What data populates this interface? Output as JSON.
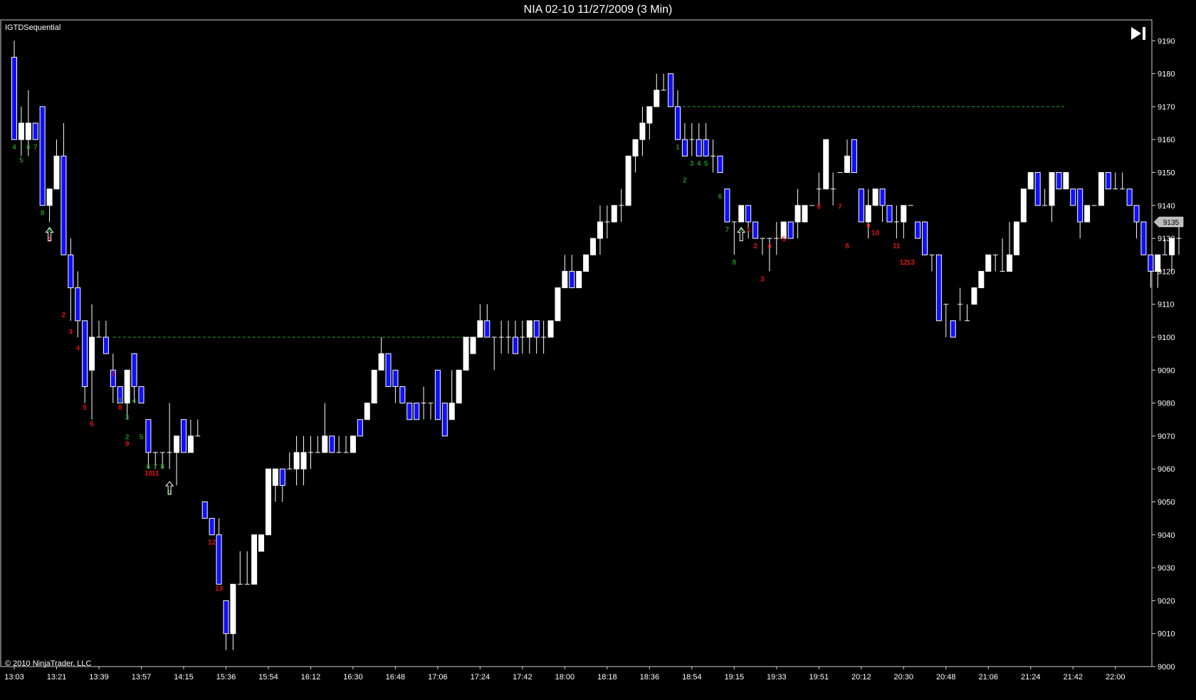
{
  "title": "NIA 02-10  11/27/2009 (3 Min)",
  "indicator_label": "IGTDSequential",
  "copyright": "© 2010 NinjaTrader, LLC",
  "last_price_label": "9135",
  "colors": {
    "background": "#000000",
    "up_candle": "#ffffff",
    "down_candle": "#1010ff",
    "setup_count": "#1e8c1e",
    "countdown_count": "#e01010",
    "support_resistance": "#1e8c1e"
  },
  "chart_data": {
    "type": "candlestick",
    "ylim": [
      9000,
      9195
    ],
    "yticks": [
      9000,
      9010,
      9020,
      9030,
      9040,
      9050,
      9060,
      9070,
      9080,
      9090,
      9100,
      9110,
      9120,
      9130,
      9140,
      9150,
      9160,
      9170,
      9180,
      9190
    ],
    "xticks": [
      "13:03",
      "13:21",
      "13:39",
      "13:57",
      "14:15",
      "15:36",
      "15:54",
      "16:12",
      "16:30",
      "16:48",
      "17:06",
      "17:24",
      "17:42",
      "18:00",
      "18:18",
      "18:36",
      "18:54",
      "19:15",
      "19:33",
      "19:51",
      "20:12",
      "20:30",
      "20:48",
      "21:06",
      "21:24",
      "21:42",
      "22:00"
    ],
    "last_price": 9135,
    "candles": [
      [
        9185,
        9190,
        9160,
        9160
      ],
      [
        9160,
        9170,
        9155,
        9165
      ],
      [
        9160,
        9175,
        9155,
        9165
      ],
      [
        9165,
        9165,
        9160,
        9160
      ],
      [
        9170,
        9170,
        9140,
        9140
      ],
      [
        9140,
        9145,
        9135,
        9145
      ],
      [
        9145,
        9160,
        9145,
        9155
      ],
      [
        9155,
        9165,
        9125,
        9125
      ],
      [
        9125,
        9130,
        9105,
        9115
      ],
      [
        9115,
        9120,
        9100,
        9105
      ],
      [
        9105,
        9105,
        9080,
        9085
      ],
      [
        9090,
        9110,
        9075,
        9100
      ],
      [
        9100,
        9105,
        9100,
        9100
      ],
      [
        9100,
        9105,
        9095,
        9095
      ],
      [
        9090,
        9095,
        9080,
        9085
      ],
      [
        9085,
        9085,
        9080,
        9080
      ],
      [
        9080,
        9090,
        9075,
        9090
      ],
      [
        9095,
        9095,
        9080,
        9085
      ],
      [
        9085,
        9085,
        9080,
        9080
      ],
      [
        9075,
        9075,
        9060,
        9065
      ],
      [
        9065,
        9065,
        9060,
        9065
      ],
      [
        9065,
        9065,
        9060,
        9065
      ],
      [
        9065,
        9080,
        9060,
        9065
      ],
      [
        9065,
        9070,
        9055,
        9070
      ],
      [
        9075,
        9075,
        9065,
        9065
      ],
      [
        9065,
        9075,
        9065,
        9070
      ],
      [
        9070,
        9075,
        9070,
        9070
      ],
      [
        9050,
        9050,
        9045,
        9045
      ],
      [
        9045,
        9045,
        9040,
        9040
      ],
      [
        9040,
        9045,
        9025,
        9025
      ],
      [
        9020,
        9020,
        9005,
        9010
      ],
      [
        9010,
        9025,
        9005,
        9025
      ],
      [
        9025,
        9035,
        9025,
        9025
      ],
      [
        9025,
        9035,
        9025,
        9025
      ],
      [
        9025,
        9040,
        9025,
        9040
      ],
      [
        9035,
        9040,
        9035,
        9040
      ],
      [
        9040,
        9060,
        9040,
        9060
      ],
      [
        9055,
        9060,
        9050,
        9060
      ],
      [
        9060,
        9060,
        9050,
        9055
      ],
      [
        9060,
        9065,
        9060,
        9060
      ],
      [
        9060,
        9070,
        9055,
        9065
      ],
      [
        9060,
        9070,
        9055,
        9065
      ],
      [
        9065,
        9070,
        9060,
        9065
      ],
      [
        9065,
        9070,
        9065,
        9065
      ],
      [
        9065,
        9080,
        9065,
        9070
      ],
      [
        9070,
        9070,
        9065,
        9065
      ],
      [
        9065,
        9070,
        9065,
        9065
      ],
      [
        9065,
        9070,
        9065,
        9065
      ],
      [
        9065,
        9070,
        9065,
        9070
      ],
      [
        9075,
        9075,
        9070,
        9070
      ],
      [
        9075,
        9080,
        9075,
        9080
      ],
      [
        9080,
        9090,
        9080,
        9090
      ],
      [
        9090,
        9100,
        9090,
        9095
      ],
      [
        9095,
        9095,
        9085,
        9085
      ],
      [
        9090,
        9090,
        9080,
        9085
      ],
      [
        9085,
        9085,
        9080,
        9080
      ],
      [
        9080,
        9080,
        9075,
        9075
      ],
      [
        9080,
        9080,
        9075,
        9075
      ],
      [
        9080,
        9085,
        9075,
        9080
      ],
      [
        9080,
        9080,
        9075,
        9080
      ],
      [
        9090,
        9090,
        9075,
        9075
      ],
      [
        9080,
        9080,
        9070,
        9070
      ],
      [
        9075,
        9090,
        9075,
        9080
      ],
      [
        9080,
        9090,
        9080,
        9090
      ],
      [
        9090,
        9100,
        9090,
        9100
      ],
      [
        9095,
        9100,
        9095,
        9100
      ],
      [
        9100,
        9110,
        9100,
        9105
      ],
      [
        9105,
        9110,
        9100,
        9100
      ],
      [
        9100,
        9100,
        9090,
        9100
      ],
      [
        9100,
        9105,
        9095,
        9100
      ],
      [
        9100,
        9105,
        9095,
        9100
      ],
      [
        9100,
        9105,
        9095,
        9095
      ],
      [
        9100,
        9105,
        9095,
        9100
      ],
      [
        9100,
        9105,
        9095,
        9105
      ],
      [
        9105,
        9105,
        9095,
        9100
      ],
      [
        9100,
        9105,
        9095,
        9100
      ],
      [
        9100,
        9105,
        9100,
        9105
      ],
      [
        9105,
        9115,
        9105,
        9115
      ],
      [
        9115,
        9125,
        9115,
        9120
      ],
      [
        9120,
        9125,
        9115,
        9115
      ],
      [
        9115,
        9120,
        9115,
        9120
      ],
      [
        9120,
        9125,
        9120,
        9125
      ],
      [
        9125,
        9130,
        9125,
        9130
      ],
      [
        9130,
        9140,
        9125,
        9135
      ],
      [
        9135,
        9140,
        9130,
        9135
      ],
      [
        9135,
        9140,
        9135,
        9140
      ],
      [
        9140,
        9145,
        9135,
        9140
      ],
      [
        9140,
        9155,
        9140,
        9155
      ],
      [
        9155,
        9160,
        9150,
        9160
      ],
      [
        9160,
        9170,
        9155,
        9165
      ],
      [
        9165,
        9170,
        9160,
        9170
      ],
      [
        9170,
        9180,
        9170,
        9175
      ],
      [
        9175,
        9180,
        9175,
        9175
      ],
      [
        9180,
        9180,
        9170,
        9170
      ],
      [
        9170,
        9175,
        9160,
        9160
      ],
      [
        9160,
        9165,
        9155,
        9155
      ],
      [
        9160,
        9165,
        9155,
        9160
      ],
      [
        9160,
        9165,
        9155,
        9155
      ],
      [
        9160,
        9165,
        9155,
        9155
      ],
      [
        9155,
        9160,
        9150,
        9155
      ],
      [
        9155,
        9155,
        9150,
        9150
      ],
      [
        9145,
        9145,
        9135,
        9135
      ],
      [
        9135,
        9135,
        9125,
        9135
      ],
      [
        9135,
        9140,
        9135,
        9140
      ],
      [
        9140,
        9140,
        9130,
        9135
      ],
      [
        9135,
        9135,
        9130,
        9130
      ],
      [
        9130,
        9130,
        9125,
        9130
      ],
      [
        9130,
        9130,
        9120,
        9130
      ],
      [
        9130,
        9135,
        9125,
        9130
      ],
      [
        9130,
        9135,
        9130,
        9135
      ],
      [
        9135,
        9135,
        9130,
        9130
      ],
      [
        9135,
        9145,
        9130,
        9140
      ],
      [
        9135,
        9140,
        9135,
        9140
      ],
      [
        9140,
        9140,
        9140,
        9140
      ],
      [
        9145,
        9150,
        9140,
        9145
      ],
      [
        9145,
        9160,
        9145,
        9160
      ],
      [
        9145,
        9150,
        9140,
        9145
      ],
      [
        9150,
        9150,
        9150,
        9150
      ],
      [
        9150,
        9160,
        9150,
        9155
      ],
      [
        9160,
        9160,
        9150,
        9150
      ],
      [
        9145,
        9145,
        9135,
        9135
      ],
      [
        9135,
        9145,
        9130,
        9140
      ],
      [
        9140,
        9145,
        9140,
        9145
      ],
      [
        9145,
        9145,
        9135,
        9140
      ],
      [
        9140,
        9140,
        9135,
        9135
      ],
      [
        9135,
        9140,
        9130,
        9135
      ],
      [
        9135,
        9140,
        9130,
        9140
      ],
      [
        9140,
        9140,
        9140,
        9140
      ],
      [
        9135,
        9135,
        9130,
        9130
      ],
      [
        9135,
        9135,
        9125,
        9125
      ],
      [
        9125,
        9125,
        9120,
        9125
      ],
      [
        9125,
        9125,
        9105,
        9105
      ],
      [
        9110,
        9110,
        9100,
        9110
      ],
      [
        9105,
        9105,
        9100,
        9100
      ],
      [
        9110,
        9115,
        9105,
        9110
      ],
      [
        9105,
        9110,
        9105,
        9105
      ],
      [
        9110,
        9115,
        9110,
        9115
      ],
      [
        9115,
        9120,
        9115,
        9120
      ],
      [
        9120,
        9125,
        9120,
        9125
      ],
      [
        9125,
        9125,
        9120,
        9125
      ],
      [
        9120,
        9130,
        9120,
        9120
      ],
      [
        9120,
        9135,
        9120,
        9125
      ],
      [
        9125,
        9135,
        9125,
        9135
      ],
      [
        9135,
        9145,
        9135,
        9145
      ],
      [
        9145,
        9150,
        9145,
        9150
      ],
      [
        9150,
        9150,
        9145,
        9140
      ],
      [
        9140,
        9145,
        9140,
        9140
      ],
      [
        9140,
        9150,
        9135,
        9150
      ],
      [
        9150,
        9150,
        9145,
        9145
      ],
      [
        9145,
        9150,
        9145,
        9150
      ],
      [
        9145,
        9145,
        9140,
        9140
      ],
      [
        9145,
        9145,
        9130,
        9135
      ],
      [
        9135,
        9140,
        9135,
        9140
      ],
      [
        9140,
        9140,
        9140,
        9140
      ],
      [
        9140,
        9150,
        9140,
        9150
      ],
      [
        9150,
        9150,
        9145,
        9145
      ],
      [
        9145,
        9150,
        9145,
        9145
      ],
      [
        9145,
        9150,
        9145,
        9145
      ],
      [
        9145,
        9145,
        9140,
        9140
      ],
      [
        9140,
        9140,
        9130,
        9135
      ],
      [
        9135,
        9135,
        9125,
        9125
      ],
      [
        9125,
        9125,
        9115,
        9120
      ],
      [
        9120,
        9125,
        9115,
        9125
      ],
      [
        9125,
        9130,
        9125,
        9125
      ],
      [
        9125,
        9130,
        9120,
        9130
      ],
      [
        9130,
        9135,
        9125,
        9130
      ]
    ],
    "counts": [
      {
        "bar": 0,
        "text": "4",
        "kind": "setup",
        "price": 9157
      },
      {
        "bar": 1,
        "text": "5",
        "kind": "setup",
        "price": 9153
      },
      {
        "bar": 2,
        "text": "6",
        "kind": "setup",
        "price": 9157
      },
      {
        "bar": 3,
        "text": "7",
        "kind": "setup",
        "price": 9157
      },
      {
        "bar": 4,
        "text": "8",
        "kind": "setup",
        "price": 9137
      },
      {
        "bar": 5,
        "text": "9",
        "kind": "setup",
        "price": 9132
      },
      {
        "bar": 5,
        "text": "1",
        "kind": "countdown",
        "price": 9129
      },
      {
        "bar": 7,
        "text": "2",
        "kind": "countdown",
        "price": 9106
      },
      {
        "bar": 8,
        "text": "3",
        "kind": "countdown",
        "price": 9101
      },
      {
        "bar": 9,
        "text": "4",
        "kind": "countdown",
        "price": 9096
      },
      {
        "bar": 10,
        "text": "5",
        "kind": "countdown",
        "price": 9078
      },
      {
        "bar": 11,
        "text": "6",
        "kind": "countdown",
        "price": 9073
      },
      {
        "bar": 14,
        "text": "7",
        "kind": "countdown",
        "price": 9088
      },
      {
        "bar": 15,
        "text": "1",
        "kind": "setup",
        "price": 9080
      },
      {
        "bar": 15,
        "text": "8",
        "kind": "countdown",
        "price": 9078
      },
      {
        "bar": 16,
        "text": "3",
        "kind": "setup",
        "price": 9075
      },
      {
        "bar": 17,
        "text": "4",
        "kind": "setup",
        "price": 9080
      },
      {
        "bar": 16,
        "text": "2",
        "kind": "setup",
        "price": 9069
      },
      {
        "bar": 16,
        "text": "9",
        "kind": "countdown",
        "price": 9067
      },
      {
        "bar": 18,
        "text": "5",
        "kind": "setup",
        "price": 9069
      },
      {
        "bar": 19,
        "text": "6",
        "kind": "setup",
        "price": 9060
      },
      {
        "bar": 20,
        "text": "7",
        "kind": "setup",
        "price": 9060
      },
      {
        "bar": 21,
        "text": "8",
        "kind": "setup",
        "price": 9060
      },
      {
        "bar": 19,
        "text": "10",
        "kind": "countdown",
        "price": 9058
      },
      {
        "bar": 20,
        "text": "11",
        "kind": "countdown",
        "price": 9058
      },
      {
        "bar": 22,
        "text": "9",
        "kind": "setup",
        "price": 9052
      },
      {
        "bar": 28,
        "text": "12",
        "kind": "countdown",
        "price": 9037
      },
      {
        "bar": 29,
        "text": "13",
        "kind": "countdown",
        "price": 9023
      },
      {
        "bar": 94,
        "text": "1",
        "kind": "setup",
        "price": 9157
      },
      {
        "bar": 95,
        "text": "2",
        "kind": "setup",
        "price": 9147
      },
      {
        "bar": 96,
        "text": "3",
        "kind": "setup",
        "price": 9152
      },
      {
        "bar": 97,
        "text": "4",
        "kind": "setup",
        "price": 9152
      },
      {
        "bar": 98,
        "text": "5",
        "kind": "setup",
        "price": 9152
      },
      {
        "bar": 100,
        "text": "6",
        "kind": "setup",
        "price": 9142
      },
      {
        "bar": 101,
        "text": "7",
        "kind": "setup",
        "price": 9132
      },
      {
        "bar": 103,
        "text": "9",
        "kind": "setup",
        "price": 9132
      },
      {
        "bar": 102,
        "text": "8",
        "kind": "setup",
        "price": 9122
      },
      {
        "bar": 104,
        "text": "1",
        "kind": "countdown",
        "price": 9132
      },
      {
        "bar": 105,
        "text": "2",
        "kind": "countdown",
        "price": 9127
      },
      {
        "bar": 106,
        "text": "3",
        "kind": "countdown",
        "price": 9117
      },
      {
        "bar": 107,
        "text": "4",
        "kind": "countdown",
        "price": 9127
      },
      {
        "bar": 109,
        "text": "5",
        "kind": "countdown",
        "price": 9129
      },
      {
        "bar": 114,
        "text": "6",
        "kind": "countdown",
        "price": 9139
      },
      {
        "bar": 117,
        "text": "7",
        "kind": "countdown",
        "price": 9139
      },
      {
        "bar": 118,
        "text": "8",
        "kind": "countdown",
        "price": 9127
      },
      {
        "bar": 121,
        "text": "9",
        "kind": "countdown",
        "price": 9133
      },
      {
        "bar": 122,
        "text": "10",
        "kind": "countdown",
        "price": 9131
      },
      {
        "bar": 125,
        "text": "11",
        "kind": "countdown",
        "price": 9127
      },
      {
        "bar": 126,
        "text": "12",
        "kind": "countdown",
        "price": 9122
      },
      {
        "bar": 127,
        "text": "13",
        "kind": "countdown",
        "price": 9122
      }
    ],
    "arrows": [
      {
        "bar": 5,
        "price": 9131
      },
      {
        "bar": 22,
        "price": 9054
      },
      {
        "bar": 103,
        "price": 9131
      }
    ],
    "levels": [
      {
        "price": 9100,
        "from_bar": 14,
        "to_bar": 66
      },
      {
        "price": 9170,
        "from_bar": 94,
        "to_bar": 149
      }
    ]
  }
}
